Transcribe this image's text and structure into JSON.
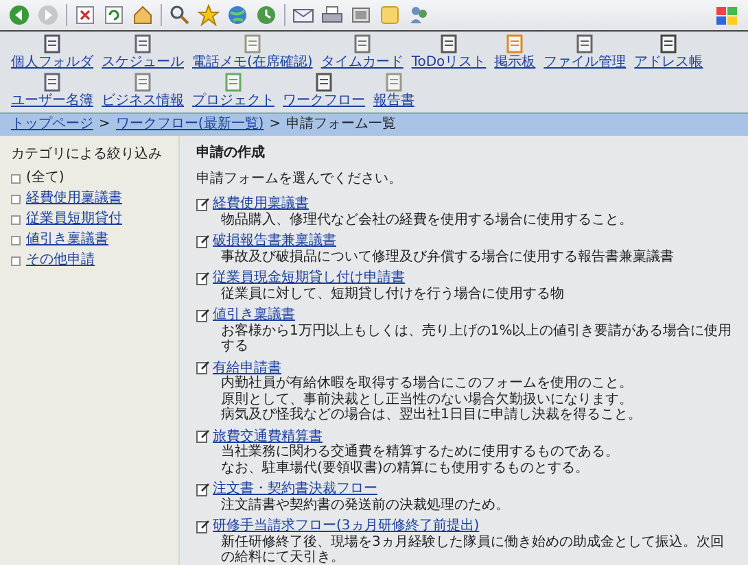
{
  "nav": {
    "items": [
      {
        "label": "個人フォルダ"
      },
      {
        "label": "スケジュール"
      },
      {
        "label": "電話メモ(在席確認)"
      },
      {
        "label": "タイムカード"
      },
      {
        "label": "ToDoリスト"
      },
      {
        "label": "掲示板"
      },
      {
        "label": "ファイル管理"
      },
      {
        "label": "アドレス帳"
      },
      {
        "label": "ユーザー名簿"
      },
      {
        "label": "ビジネス情報"
      },
      {
        "label": "プロジェクト"
      },
      {
        "label": "ワークフロー"
      },
      {
        "label": "報告書"
      }
    ]
  },
  "breadcrumb": [
    {
      "label": "トップページ",
      "kind": "link"
    },
    {
      "label": ">",
      "kind": "separator"
    },
    {
      "label": "ワークフロー(最新一覧)",
      "kind": "link"
    },
    {
      "label": ">",
      "kind": "separator"
    },
    {
      "label": "申請フォーム一覧",
      "kind": "current"
    }
  ],
  "sidebar": {
    "title": "カテゴリによる絞り込み",
    "items": [
      {
        "label": "(全て)",
        "kind": "plain"
      },
      {
        "label": "経費使用稟議書",
        "kind": "link"
      },
      {
        "label": "従業員短期貸付",
        "kind": "link"
      },
      {
        "label": "値引き稟議書",
        "kind": "link"
      },
      {
        "label": "その他申請",
        "kind": "link"
      }
    ]
  },
  "main": {
    "title": "申請の作成",
    "intro": "申請フォームを選んでください。",
    "forms": [
      {
        "title": "経費使用稟議書",
        "description": [
          "物品購入、修理代など会社の経費を使用する場合に使用すること。"
        ]
      },
      {
        "title": "破損報告書兼稟議書",
        "description": [
          "事故及び破損品について修理及び弁償する場合に使用する報告書兼稟議書"
        ]
      },
      {
        "title": "従業員現金短期貸し付け申請書",
        "description": [
          "従業員に対して、短期貸し付けを行う場合に使用する物"
        ]
      },
      {
        "title": "値引き稟議書",
        "description": [
          "お客様から1万円以上もしくは、売り上げの1%以上の値引き要請がある場合に使用する"
        ]
      },
      {
        "title": "有給申請書",
        "description": [
          "内勤社員が有給休暇を取得する場合にこのフォームを使用のこと。",
          "原則として、事前決裁とし正当性のない場合欠勤扱いになります。",
          "病気及び怪我などの場合は、翌出社1日目に申請し決裁を得ること。"
        ]
      },
      {
        "title": "旅費交通費精算書",
        "description": [
          "当社業務に関わる交通費を精算するために使用するものである。",
          "なお、駐車場代(要領収書)の精算にも使用するものとする。"
        ]
      },
      {
        "title": "注文書・契約書決裁フロー",
        "description": [
          "注文請書や契約書の発送前の決裁処理のため。"
        ]
      },
      {
        "title": "研修手当請求フロー(3ヵ月研修終了前提出)",
        "description": [
          "新任研修終了後、現場を3ヵ月経験した隊員に働き始めの助成金として振込。次回の給料にて天引き。"
        ]
      }
    ]
  }
}
